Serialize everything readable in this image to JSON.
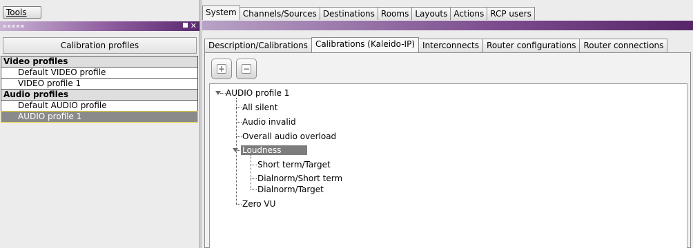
{
  "left_panel": {
    "tools_label": "Tools",
    "profiles_header": "Calibration profiles",
    "groups": [
      {
        "label": "Video profiles",
        "items": [
          "Default VIDEO profile",
          "VIDEO profile 1"
        ]
      },
      {
        "label": "Audio profiles",
        "items": [
          "Default AUDIO profile",
          "AUDIO profile 1"
        ]
      }
    ],
    "selected_item": "AUDIO profile 1"
  },
  "main_tabs": [
    "System",
    "Channels/Sources",
    "Destinations",
    "Rooms",
    "Layouts",
    "Actions",
    "RCP users"
  ],
  "main_tabs_active": "System",
  "sub_tabs": [
    "Description/Calibrations",
    "Calibrations (Kaleido-IP)",
    "Interconnects",
    "Router configurations",
    "Router connections"
  ],
  "sub_tabs_active": "Calibrations (Kaleido-IP)",
  "toolbar": {
    "expand_icon": "plus-box-icon",
    "collapse_icon": "minus-box-icon"
  },
  "tree": {
    "root": "AUDIO profile 1",
    "children": [
      "All silent",
      "Audio invalid",
      "Overall audio overload",
      "Loudness",
      "Zero VU"
    ],
    "loudness_children": [
      "Short term/Target",
      "Dialnorm/Short term",
      "Dialnorm/Target"
    ],
    "selected": "Loudness"
  },
  "colors": {
    "accent_purple": "#6a3a7e",
    "selected_gray": "#7d7d7d",
    "selected_border": "#e0cf3a"
  }
}
